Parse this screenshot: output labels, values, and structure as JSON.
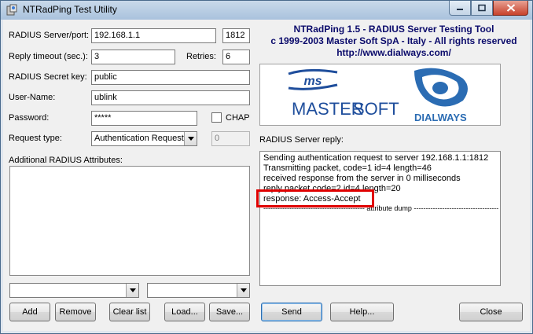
{
  "window": {
    "title": "NTRadPing Test Utility"
  },
  "form": {
    "server_label": "RADIUS Server/port:",
    "server_value": "192.168.1.1",
    "port_value": "1812",
    "timeout_label": "Reply timeout (sec.):",
    "timeout_value": "3",
    "retries_label": "Retries:",
    "retries_value": "6",
    "secret_label": "RADIUS Secret key:",
    "secret_value": "public",
    "username_label": "User-Name:",
    "username_value": "ublink",
    "password_label": "Password:",
    "password_value": "*****",
    "chap_label": "CHAP",
    "request_type_label": "Request type:",
    "request_type_value": "Authentication Request",
    "request_number_value": "0",
    "attributes_label": "Additional RADIUS Attributes:"
  },
  "header": {
    "line1": "NTRadPing 1.5 - RADIUS Server Testing Tool",
    "line2": "c 1999-2003 Master Soft SpA - Italy - All rights reserved",
    "line3": "http://www.dialways.com/"
  },
  "logos": {
    "ms": "ms",
    "master": "MASTER",
    "soft": "SOFT",
    "dialways": "DIALWAYS"
  },
  "reply": {
    "label": "RADIUS Server reply:",
    "lines": [
      "Sending authentication request to server 192.168.1.1:1812",
      "Transmitting packet, code=1 id=4 length=46",
      "received response from the server in 0 milliseconds",
      "reply packet code=2 id=4 length=20",
      "response: Access-Accept",
      "------------------------------------------- attribute dump ------------------------------------"
    ]
  },
  "buttons": {
    "add": "Add",
    "remove": "Remove",
    "clear": "Clear list",
    "load": "Load...",
    "save": "Save...",
    "send": "Send",
    "help": "Help...",
    "close": "Close"
  },
  "colors": {
    "header_text": "#0b0b6b",
    "highlight": "#e00000",
    "ms_blue": "#1f4e9c"
  }
}
